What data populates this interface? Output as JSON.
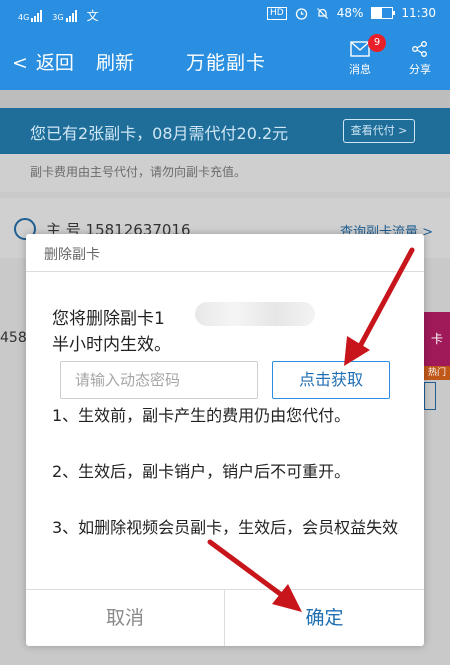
{
  "status_bar": {
    "carrier1": "4G",
    "carrier2": "3G",
    "extra_icon": "文",
    "hd": "HD",
    "battery": "48%",
    "battery_level": 0.48,
    "time": "11:30"
  },
  "navbar": {
    "back_label": "返回",
    "refresh_label": "刷新",
    "title": "万能副卡",
    "messages_label": "消息",
    "messages_badge": "9",
    "share_label": "分享"
  },
  "background": {
    "banner_text": "您已有2张副卡，08月需代付20.2元",
    "banner_button": "查看代付 >",
    "note": "副卡费用由主号代付，请勿向副卡充值。",
    "host_label": "主 号 15812637016",
    "query_link": "查询副卡流量 >",
    "partial_number": "458",
    "side_tag": "卡",
    "hot_tag": "热门"
  },
  "dialog": {
    "title": "删除副卡",
    "line1": "您将删除副卡1",
    "line2": "半小时内生效。",
    "code_placeholder": "请输入动态密码",
    "get_code_button": "点击获取",
    "rules": [
      "1、生效前，副卡产生的费用仍由您代付。",
      "2、生效后，副卡销户，销户后不可重开。",
      "3、如删除视频会员副卡，生效后，会员权益失效"
    ],
    "cancel_button": "取消",
    "confirm_button": "确定"
  },
  "colors": {
    "brand_blue": "#2a8fe0",
    "link_blue": "#1f6fb3",
    "annotation_red": "#c8151b"
  }
}
